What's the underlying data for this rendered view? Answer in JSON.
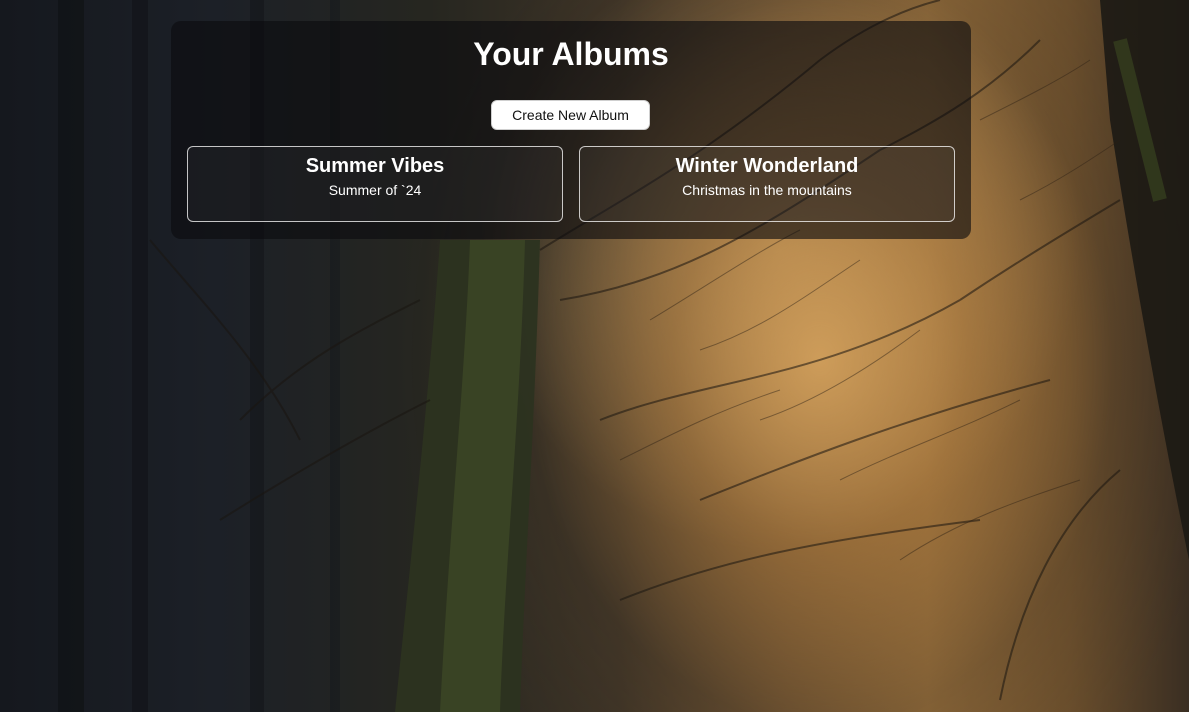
{
  "page": {
    "title": "Your Albums",
    "create_button_label": "Create New Album"
  },
  "albums": [
    {
      "name": "Summer Vibes",
      "description": "Summer of `24"
    },
    {
      "name": "Winter Wonderland",
      "description": "Christmas in the mountains"
    }
  ],
  "background": {
    "icon": "forest-background-image"
  },
  "colors": {
    "panel_bg": "#0c0c0e",
    "text": "#ffffff",
    "button_bg": "#ffffff",
    "button_text": "#111111"
  }
}
